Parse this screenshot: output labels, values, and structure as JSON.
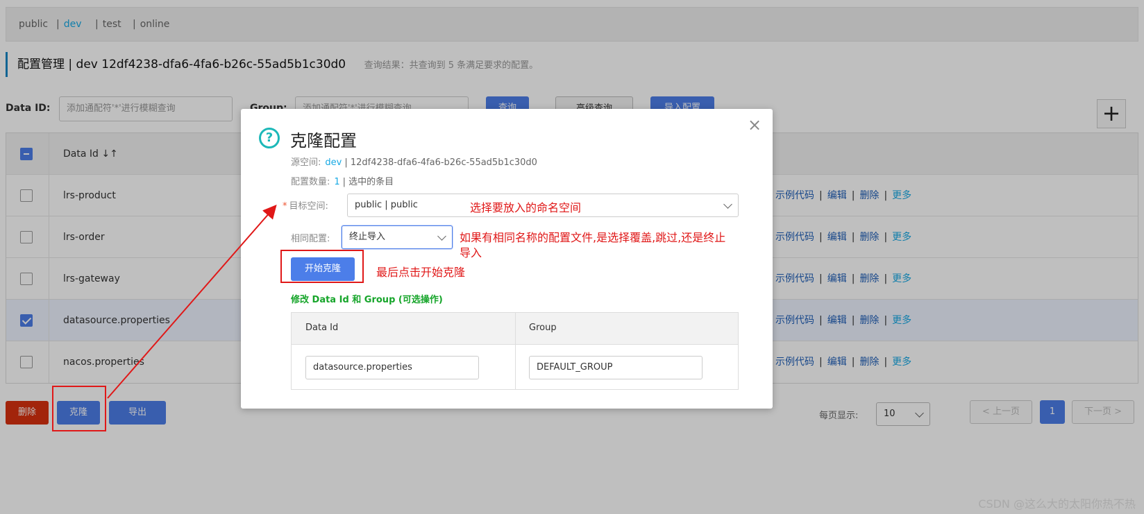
{
  "namespaces": [
    {
      "label": "public",
      "active": false
    },
    {
      "label": "dev",
      "active": true
    },
    {
      "label": "test",
      "active": false
    },
    {
      "label": "online",
      "active": false
    }
  ],
  "header": {
    "title": "配置管理  |  dev   12df4238-dfa6-4fa6-b26c-55ad5b1c30d0",
    "result": "查询结果：共查询到 5 条满足要求的配置。"
  },
  "search": {
    "data_id_label": "Data ID:",
    "data_id_placeholder": "添加通配符'*'进行模糊查询",
    "group_label": "Group:",
    "group_placeholder": "添加通配符'*'进行模糊查询",
    "query_btn": "查询",
    "advanced_btn": "高级查询",
    "import_btn": "导入配置",
    "add_btn": "+"
  },
  "table": {
    "header_data_id": "Data Id ↓↑",
    "rows": [
      {
        "id": "lrs-product",
        "checked": false
      },
      {
        "id": "lrs-order",
        "checked": false
      },
      {
        "id": "lrs-gateway",
        "checked": false
      },
      {
        "id": "datasource.properties",
        "checked": true
      },
      {
        "id": "nacos.properties",
        "checked": false
      }
    ],
    "ops": {
      "sample": "示例代码",
      "edit": "编辑",
      "delete": "删除",
      "more": "更多"
    }
  },
  "footer": {
    "delete_btn": "删除",
    "clone_btn": "克隆",
    "export_btn": "导出",
    "page_size_label": "每页显示:",
    "page_size": "10",
    "prev": "< 上一页",
    "current_page": "1",
    "next": "下一页 >"
  },
  "dialog": {
    "title": "克隆配置",
    "source_label": "源空间:",
    "source_ns": "dev",
    "source_id": "| 12df4238-dfa6-4fa6-b26c-55ad5b1c30d0",
    "count_label": "配置数量:",
    "count": "1",
    "count_desc": "| 选中的条目",
    "target_label": "目标空间:",
    "target_value": "public | public",
    "same_label": "相同配置:",
    "same_value": "终止导入",
    "start_btn": "开始克隆",
    "modify_title": "修改 Data Id 和 Group (可选操作)",
    "col_data_id": "Data Id",
    "col_group": "Group",
    "data_id_value": "datasource.properties",
    "group_value": "DEFAULT_GROUP"
  },
  "annotations": {
    "target_note": "选择要放入的命名空间",
    "same_note_1": "如果有相同名称的配置文件,是选择覆盖,跳过,还是终止",
    "same_note_2": "导入",
    "start_note": "最后点击开始克隆"
  },
  "watermark": "CSDN @这么大的太阳你热不热",
  "colors": {
    "primary": "#4c7ee9",
    "danger": "#d9300f",
    "link": "#17a9e4",
    "annotation": "#e01818",
    "green": "#16a52a"
  }
}
